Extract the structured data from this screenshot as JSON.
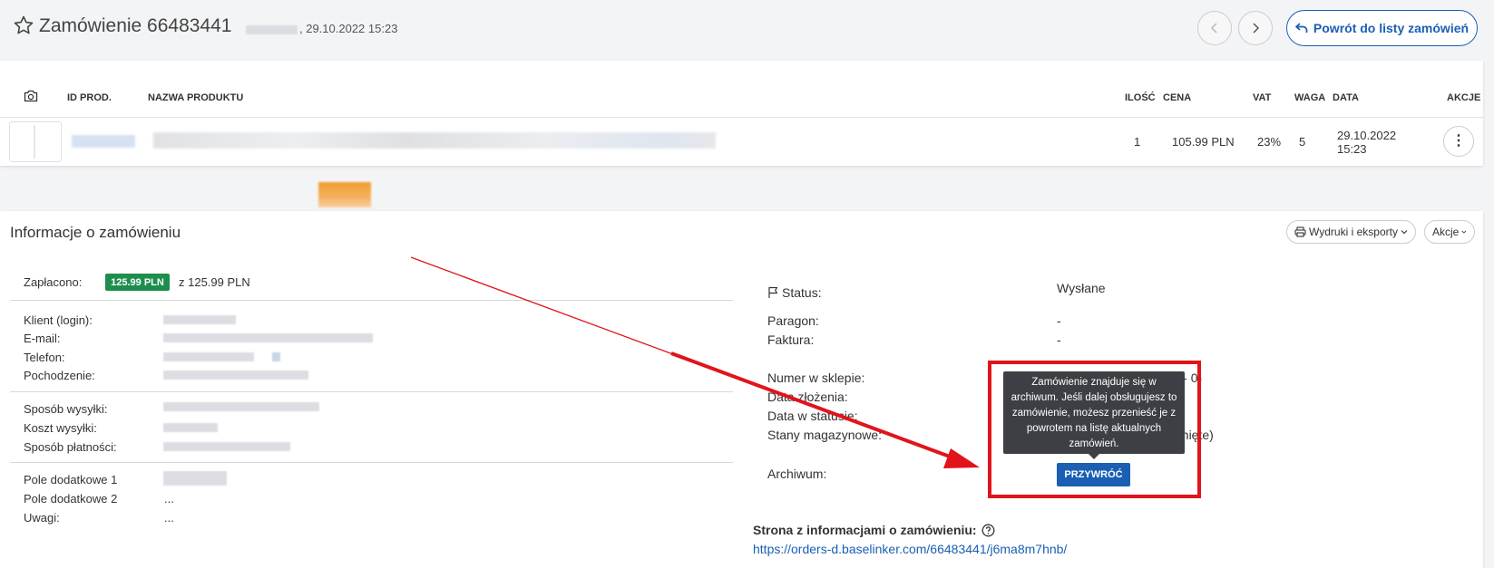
{
  "header": {
    "title": "Zamówienie 66483441",
    "date": ", 29.10.2022 15:23",
    "back_label": "Powrót do listy zamówień"
  },
  "products": {
    "columns": {
      "id": "ID PROD.",
      "name": "NAZWA PRODUKTU",
      "qty": "ILOŚĆ",
      "price": "CENA",
      "vat": "VAT",
      "weight": "WAGA",
      "date": "DATA",
      "actions": "AKCJE"
    },
    "row": {
      "qty": "1",
      "price": "105.99 PLN",
      "vat": "23%",
      "weight": "5",
      "date_line1": "29.10.2022",
      "date_line2": "15:23",
      "actions_glyph": "⋮"
    }
  },
  "info": {
    "title": "Informacje o zamówieniu",
    "print_label": "Wydruki i eksporty",
    "actions_label": "Akcje",
    "paid_label": "Zapłacono:",
    "paid_badge": "125.99 PLN",
    "paid_total": "z 125.99 PLN",
    "left_labels": {
      "client": "Klient (login):",
      "email": "E-mail:",
      "phone": "Telefon:",
      "origin": "Pochodzenie:",
      "shipping": "Sposób wysyłki:",
      "shipping_cost": "Koszt wysyłki:",
      "payment": "Sposób płatności:",
      "extra1": "Pole dodatkowe 1",
      "extra2": "Pole dodatkowe 2",
      "notes": "Uwagi:"
    },
    "extra2_value": "...",
    "notes_value": "...",
    "right": {
      "status_label": "Status:",
      "status_value": "Wysłane",
      "receipt_label": "Paragon:",
      "receipt_value": "-",
      "invoice_label": "Faktura:",
      "invoice_value": "-",
      "shop_number_label": "Numer w sklepie:",
      "shop_number_tail": "neta - 0)",
      "placed_label": "Data złożenia:",
      "status_date_label": "Data w statusie:",
      "stock_label": "Stany magazynowe:",
      "stock_tail": "gnięte)",
      "archive_label": "Archiwum:",
      "restore_label": "PRZYWRÓĆ",
      "tooltip": "Zamówienie znajduje się w archiwum. Jeśli dalej obsługujesz to zamówienie, możesz przenieść je z powrotem na listę aktualnych zamówień."
    },
    "page_info_label": "Strona z informacjami o zamówieniu:",
    "page_info_link": "https://orders-d.baselinker.com/66483441/j6ma8m7hnb/"
  },
  "colors": {
    "accent": "#1a5fb4",
    "paid_green": "#1e8e4e",
    "highlight_red": "#e1141b",
    "tooltip_bg": "#3d3f44"
  }
}
